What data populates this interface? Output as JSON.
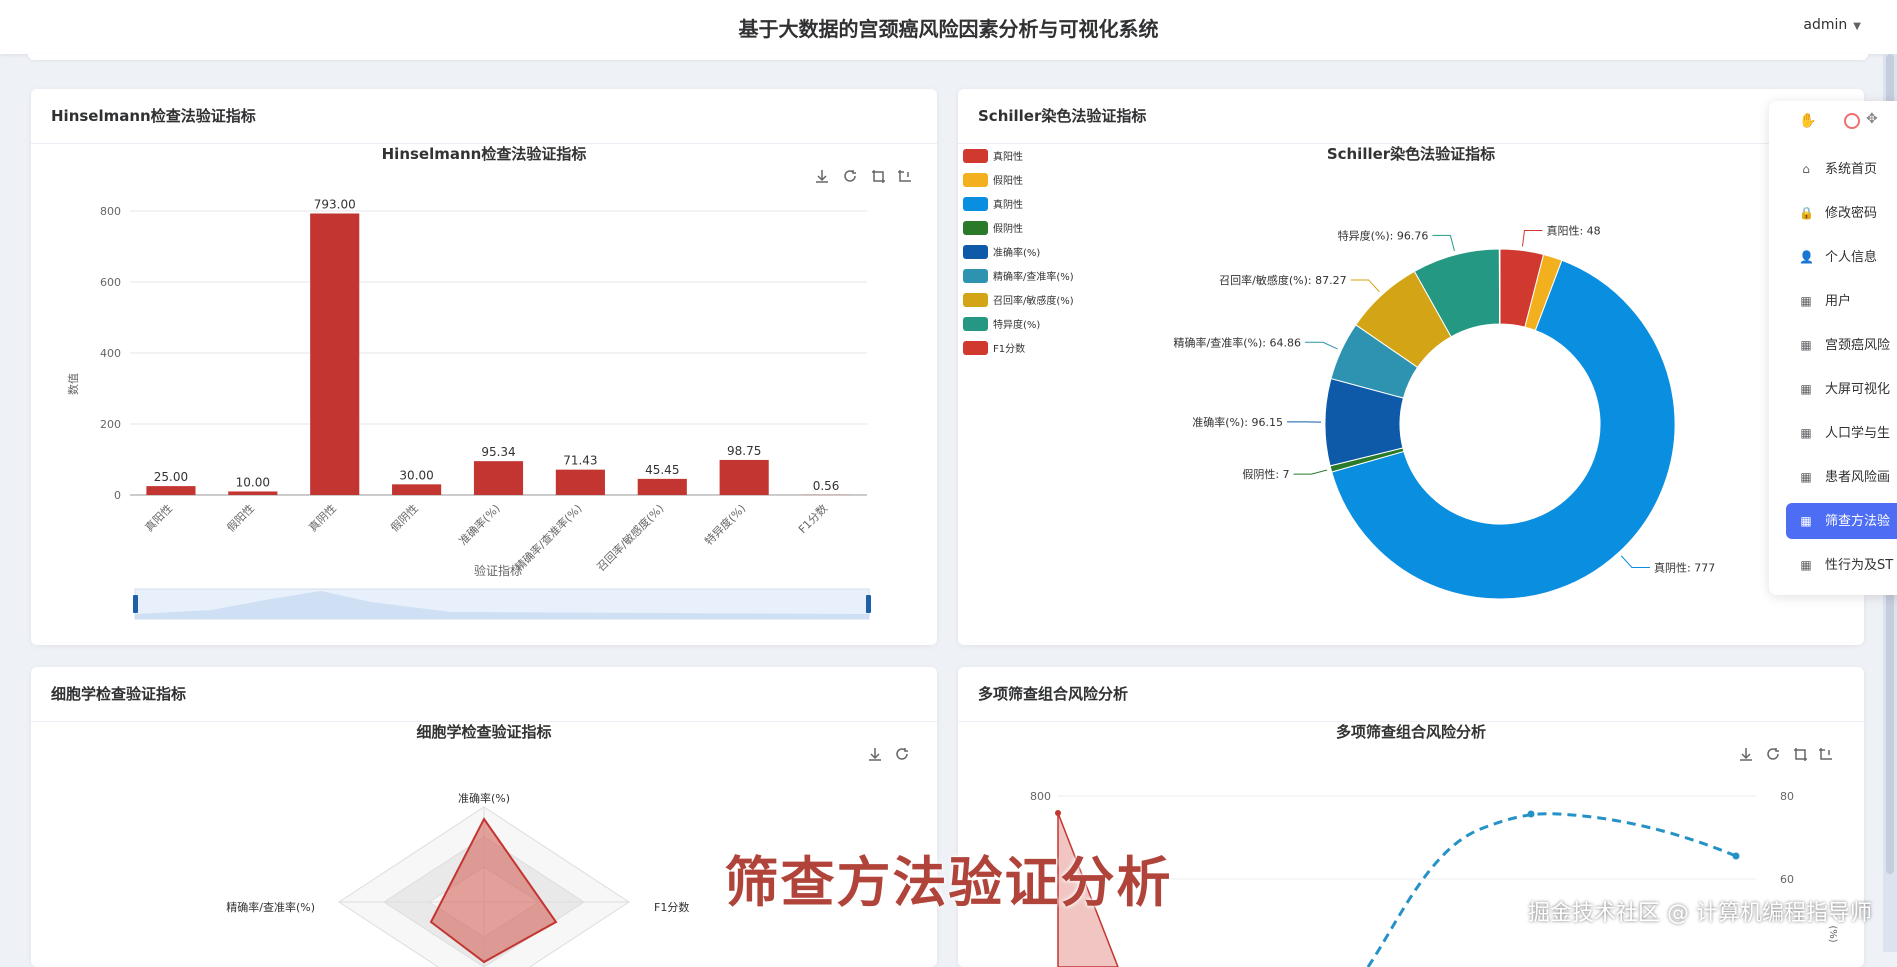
{
  "header": {
    "title": "基于大数据的宫颈癌风险因素分析与可视化系统",
    "user": "admin"
  },
  "cards": {
    "hinselmann": {
      "heading": "Hinselmann检查法验证指标"
    },
    "schiller": {
      "heading": "Schiller染色法验证指标"
    },
    "cytology": {
      "heading": "细胞学检查验证指标"
    },
    "combo": {
      "heading": "多项筛查组合风险分析"
    }
  },
  "chart_data": [
    {
      "type": "bar",
      "title": "Hinselmann检查法验证指标",
      "xlabel": "验证指标",
      "ylabel": "数值",
      "categories": [
        "真阳性",
        "假阳性",
        "真阴性",
        "假阴性",
        "准确率(%)",
        "精确率/查准率(%)",
        "召回率/敏感度(%)",
        "特异度(%)",
        "F1分数"
      ],
      "values": [
        25.0,
        10.0,
        793.0,
        30.0,
        95.34,
        71.43,
        45.45,
        98.75,
        0.56
      ],
      "value_labels": [
        "25.00",
        "10.00",
        "793.00",
        "30.00",
        "95.34",
        "71.43",
        "45.45",
        "98.75",
        "0.56"
      ],
      "yticks": [
        "0",
        "200",
        "400",
        "600",
        "800"
      ],
      "ylim": [
        0,
        800
      ],
      "color": "#c23531",
      "grid": true
    },
    {
      "type": "pie",
      "title": "Schiller染色法验证指标",
      "legend_position": "left",
      "slices": [
        {
          "name": "真阳性",
          "value": 48,
          "color": "#d0392f",
          "label": "真阳性: 48"
        },
        {
          "name": "假阳性",
          "value": 21,
          "color": "#f2b01e",
          "label": ""
        },
        {
          "name": "真阴性",
          "value": 777,
          "color": "#0a8ee0",
          "label": "真阴性: 777"
        },
        {
          "name": "假阴性",
          "value": 7,
          "color": "#2a7a2a",
          "label": "假阴性: 7"
        },
        {
          "name": "准确率(%)",
          "value": 96.15,
          "color": "#0f5aa8",
          "label": "准确率(%): 96.15"
        },
        {
          "name": "精确率/查准率(%)",
          "value": 64.86,
          "color": "#2e93b0",
          "label": "精确率/查准率(%): 64.86"
        },
        {
          "name": "召回率/敏感度(%)",
          "value": 87.27,
          "color": "#d4a417",
          "label": "召回率/敏感度(%): 87.27"
        },
        {
          "name": "特异度(%)",
          "value": 96.76,
          "color": "#259884",
          "label": "特异度(%): 96.76"
        },
        {
          "name": "F1分数",
          "value": 0.7,
          "color": "#d0392f",
          "label": ""
        }
      ]
    },
    {
      "type": "radar",
      "title": "细胞学检查验证指标",
      "indicators": [
        "准确率(%)",
        "F1分数",
        "精确率/查准率(%)"
      ]
    },
    {
      "type": "line",
      "title": "多项筛查组合风险分析",
      "y_left_ticks": [
        "800"
      ],
      "y_right_ticks": [
        "80",
        "60"
      ],
      "y_right_label": "(%)"
    }
  ],
  "tooltip_menu": {
    "items": [
      "系统首页",
      "修改密码",
      "个人信息",
      "用户",
      "宫颈癌风险",
      "大屏可视化",
      "人口学与生",
      "患者风险画",
      "筛查方法验",
      "性行为及ST"
    ],
    "active_index": 8
  },
  "caption": "筛查方法验证分析",
  "watermark": "掘金技术社区 @ 计算机编程指导师"
}
